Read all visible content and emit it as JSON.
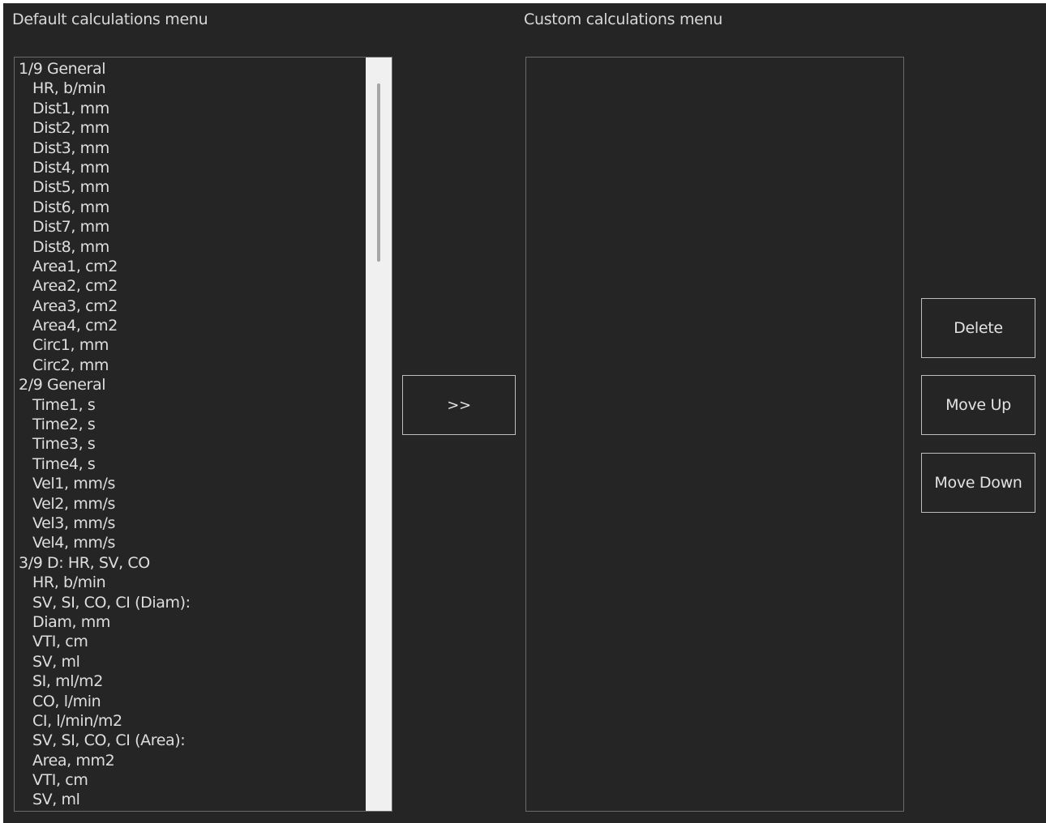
{
  "left_panel": {
    "caption": "Default calculations menu",
    "items": [
      {
        "label": "1/9 General",
        "type": "group"
      },
      {
        "label": "HR, b/min",
        "type": "item"
      },
      {
        "label": "Dist1, mm",
        "type": "item"
      },
      {
        "label": "Dist2, mm",
        "type": "item"
      },
      {
        "label": "Dist3, mm",
        "type": "item"
      },
      {
        "label": "Dist4, mm",
        "type": "item"
      },
      {
        "label": "Dist5, mm",
        "type": "item"
      },
      {
        "label": "Dist6, mm",
        "type": "item"
      },
      {
        "label": "Dist7, mm",
        "type": "item"
      },
      {
        "label": "Dist8, mm",
        "type": "item"
      },
      {
        "label": "Area1, cm2",
        "type": "item"
      },
      {
        "label": "Area2, cm2",
        "type": "item"
      },
      {
        "label": "Area3, cm2",
        "type": "item"
      },
      {
        "label": "Area4, cm2",
        "type": "item"
      },
      {
        "label": "Circ1, mm",
        "type": "item"
      },
      {
        "label": "Circ2, mm",
        "type": "item"
      },
      {
        "label": "2/9 General",
        "type": "group"
      },
      {
        "label": "Time1, s",
        "type": "item"
      },
      {
        "label": "Time2, s",
        "type": "item"
      },
      {
        "label": "Time3, s",
        "type": "item"
      },
      {
        "label": "Time4, s",
        "type": "item"
      },
      {
        "label": "Vel1, mm/s",
        "type": "item"
      },
      {
        "label": "Vel2, mm/s",
        "type": "item"
      },
      {
        "label": "Vel3, mm/s",
        "type": "item"
      },
      {
        "label": "Vel4, mm/s",
        "type": "item"
      },
      {
        "label": "3/9 D: HR, SV, CO",
        "type": "group"
      },
      {
        "label": "HR, b/min",
        "type": "item"
      },
      {
        "label": "SV, SI, CO, CI (Diam):",
        "type": "item"
      },
      {
        "label": "Diam, mm",
        "type": "item"
      },
      {
        "label": "VTI, cm",
        "type": "item"
      },
      {
        "label": "SV, ml",
        "type": "item"
      },
      {
        "label": "SI, ml/m2",
        "type": "item"
      },
      {
        "label": "CO, l/min",
        "type": "item"
      },
      {
        "label": "CI, l/min/m2",
        "type": "item"
      },
      {
        "label": "SV, SI, CO, CI (Area):",
        "type": "item"
      },
      {
        "label": "Area, mm2",
        "type": "item"
      },
      {
        "label": "VTI, cm",
        "type": "item"
      },
      {
        "label": "SV, ml",
        "type": "item"
      }
    ]
  },
  "right_panel": {
    "caption": "Custom calculations menu",
    "items": []
  },
  "buttons": {
    "add": ">>",
    "delete": "Delete",
    "move_up": "Move Up",
    "move_down": "Move Down"
  },
  "colors": {
    "background": "#252525",
    "text": "#dedede",
    "border": "#6a6a6a",
    "scrollbar_track": "#f0f0f0"
  }
}
